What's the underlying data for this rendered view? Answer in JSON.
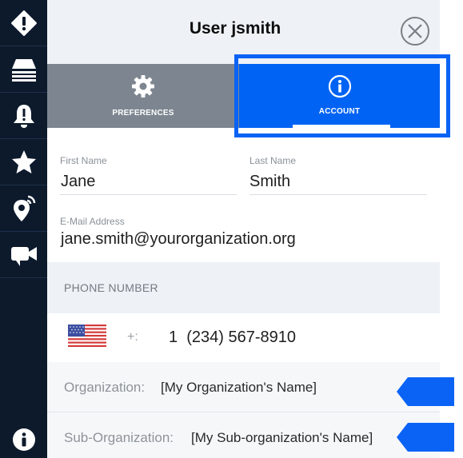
{
  "rail": {
    "icons": [
      "alert-icon",
      "layers-icon",
      "bell-icon",
      "star-icon",
      "location-pin-icon",
      "video-camera-icon"
    ],
    "bottom_icon": "info-icon"
  },
  "header": {
    "title": "User jsmith",
    "close_icon": "close-icon"
  },
  "tabs": [
    {
      "label": "PREFERENCES",
      "icon": "gear-icon",
      "active": false
    },
    {
      "label": "ACCOUNT",
      "icon": "info-icon",
      "active": true
    }
  ],
  "form": {
    "first_name_label": "First Name",
    "first_name_value": "Jane",
    "last_name_label": "Last Name",
    "last_name_value": "Smith",
    "email_label": "E-Mail Address",
    "email_value": "jane.smith@yourorganization.org"
  },
  "phone": {
    "section_title": "PHONE NUMBER",
    "country_flag": "us-flag-icon",
    "plus_text": "+:",
    "number": "1  (234) 567-8910"
  },
  "organization": {
    "label": "Organization:",
    "value": "[My Organization's Name]"
  },
  "sub_organization": {
    "label": "Sub-Organization:",
    "value": "[My Sub-organization's Name]"
  },
  "colors": {
    "rail_bg": "#0c1a2c",
    "accent_blue": "#0063f4",
    "tab_inactive": "#7d8690",
    "header_bg": "#eef1f6"
  }
}
